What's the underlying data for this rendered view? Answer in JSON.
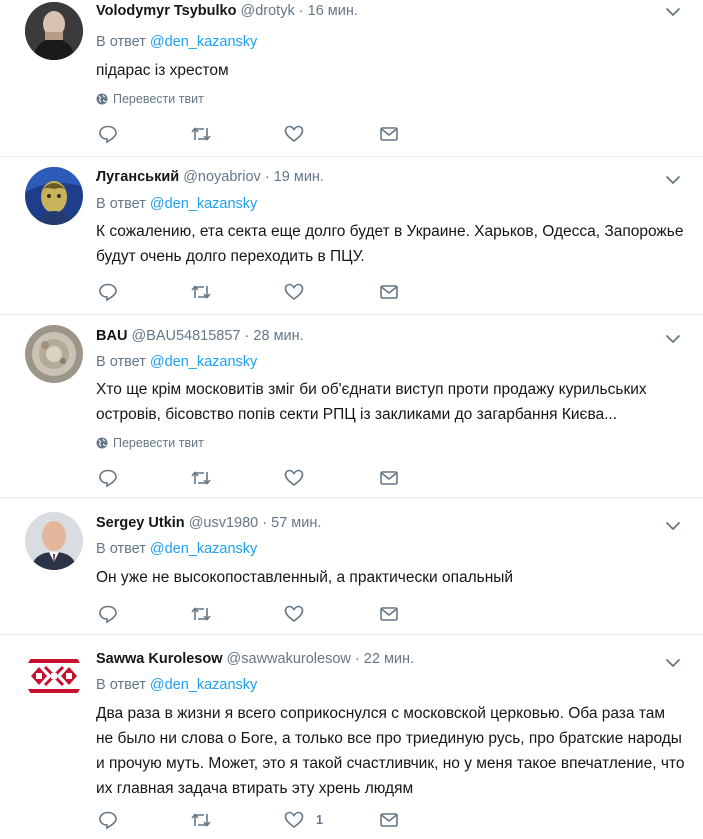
{
  "tweets": [
    {
      "name": "Volodymyr Tsybulko",
      "handle": "@drotyk",
      "dot": "·",
      "time": "16 мин.",
      "reply_prefix": "В ответ",
      "reply_to": "@den_kazansky",
      "text": "підарас із хрестом",
      "translate": "Перевести твит",
      "likes_count": "",
      "avatar_icon": "avatar-photo"
    },
    {
      "name": "Луганський",
      "handle": "@noyabriov",
      "dot": "·",
      "time": "19 мин.",
      "reply_prefix": "В ответ",
      "reply_to": "@den_kazansky",
      "text": "К сожалению, ета секта еще долго будет в Украине. Харьков, Одесса, Запорожье будут очень долго переходить в ПЦУ.",
      "translate": "",
      "likes_count": "",
      "avatar_icon": "avatar-photo"
    },
    {
      "name": "BAU",
      "handle": "@BAU54815857",
      "dot": "·",
      "time": "28 мин.",
      "reply_prefix": "В ответ",
      "reply_to": "@den_kazansky",
      "text": "Хто ще крім московитів зміг би об'єднати виступ проти продажу курильських островів, бісовство попів секти РПЦ із закликами до загарбання Києва...",
      "translate": "Перевести твит",
      "likes_count": "",
      "avatar_icon": "avatar-photo"
    },
    {
      "name": "Sergey Utkin",
      "handle": "@usv1980",
      "dot": "·",
      "time": "57 мин.",
      "reply_prefix": "В ответ",
      "reply_to": "@den_kazansky",
      "text": "Он уже не высокопоставленный, а практически опальный",
      "translate": "",
      "likes_count": "",
      "avatar_icon": "avatar-photo"
    },
    {
      "name": "Sawwa Kurolesow",
      "handle": "@sawwakurolesow",
      "dot": "·",
      "time": "22 мин.",
      "reply_prefix": "В ответ",
      "reply_to": "@den_kazansky",
      "text": "Два раза в жизни я всего соприкоснулся с московской церковью.  Оба раза там не было ни слова о Боге, а только все про триединую русь,  про братские народы и прочую муть.  Может, это я такой счастливчик,  но у меня такое впечатление,  что их главная задача втирать эту хрень людям",
      "translate": "",
      "likes_count": "1",
      "avatar_icon": "avatar-pattern"
    }
  ],
  "colors": {
    "link": "#1da1f2",
    "muted": "#657786",
    "text": "#14171a",
    "divider": "#e6ecf0"
  }
}
